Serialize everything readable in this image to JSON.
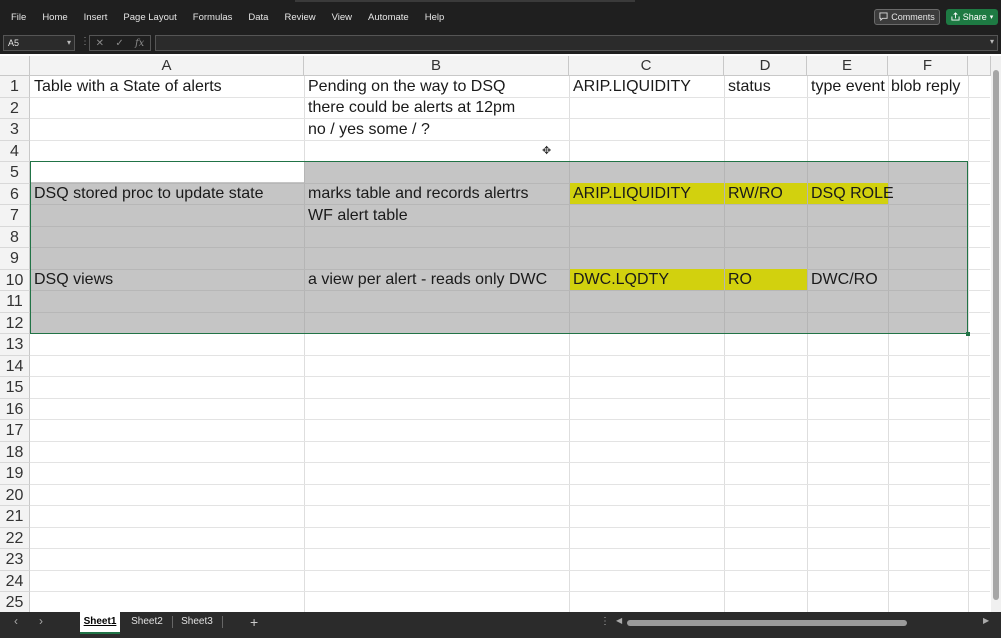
{
  "menu": [
    "File",
    "Home",
    "Insert",
    "Page Layout",
    "Formulas",
    "Data",
    "Review",
    "View",
    "Automate",
    "Help"
  ],
  "comments_button": {
    "icon": "comment-icon",
    "label": "Comments"
  },
  "share_button": {
    "icon": "share-icon",
    "label": "Share"
  },
  "formula_bar": {
    "name_box": "A5",
    "formula": "",
    "fx_label": "fx"
  },
  "columns": [
    "A",
    "B",
    "C",
    "D",
    "E",
    "F"
  ],
  "rows": [
    "1",
    "2",
    "3",
    "4",
    "5",
    "6",
    "7",
    "8",
    "9",
    "10",
    "11",
    "12",
    "13",
    "14",
    "15",
    "16",
    "17",
    "18",
    "19",
    "20",
    "21",
    "22",
    "23",
    "24",
    "25"
  ],
  "cells": {
    "A1": "Table with a State of alerts",
    "B1": "Pending on the way to DSQ",
    "B2": "there could be alerts at 12pm",
    "B3": "no / yes some /  ?",
    "C1": "ARIP.LIQUIDITY",
    "D1": "status",
    "E1": "type event",
    "F1": "blob reply",
    "A6": "DSQ stored proc to update state",
    "B6": "marks table and records alertrs",
    "B7": "WF alert table",
    "C6": "ARIP.LIQUIDITY",
    "D6": "RW/RO",
    "E6": "DSQ ROLE",
    "A10": "DSQ views",
    "B10": "a view per alert - reads only DWC",
    "C10": "DWC.LQDTY",
    "D10": "RO",
    "E10": "DWC/RO"
  },
  "selection": "A5:F12",
  "highlight_color": "#d2d10e",
  "sheets": [
    "Sheet1",
    "Sheet2",
    "Sheet3"
  ],
  "active_sheet": "Sheet1",
  "accent_color": "#217346"
}
